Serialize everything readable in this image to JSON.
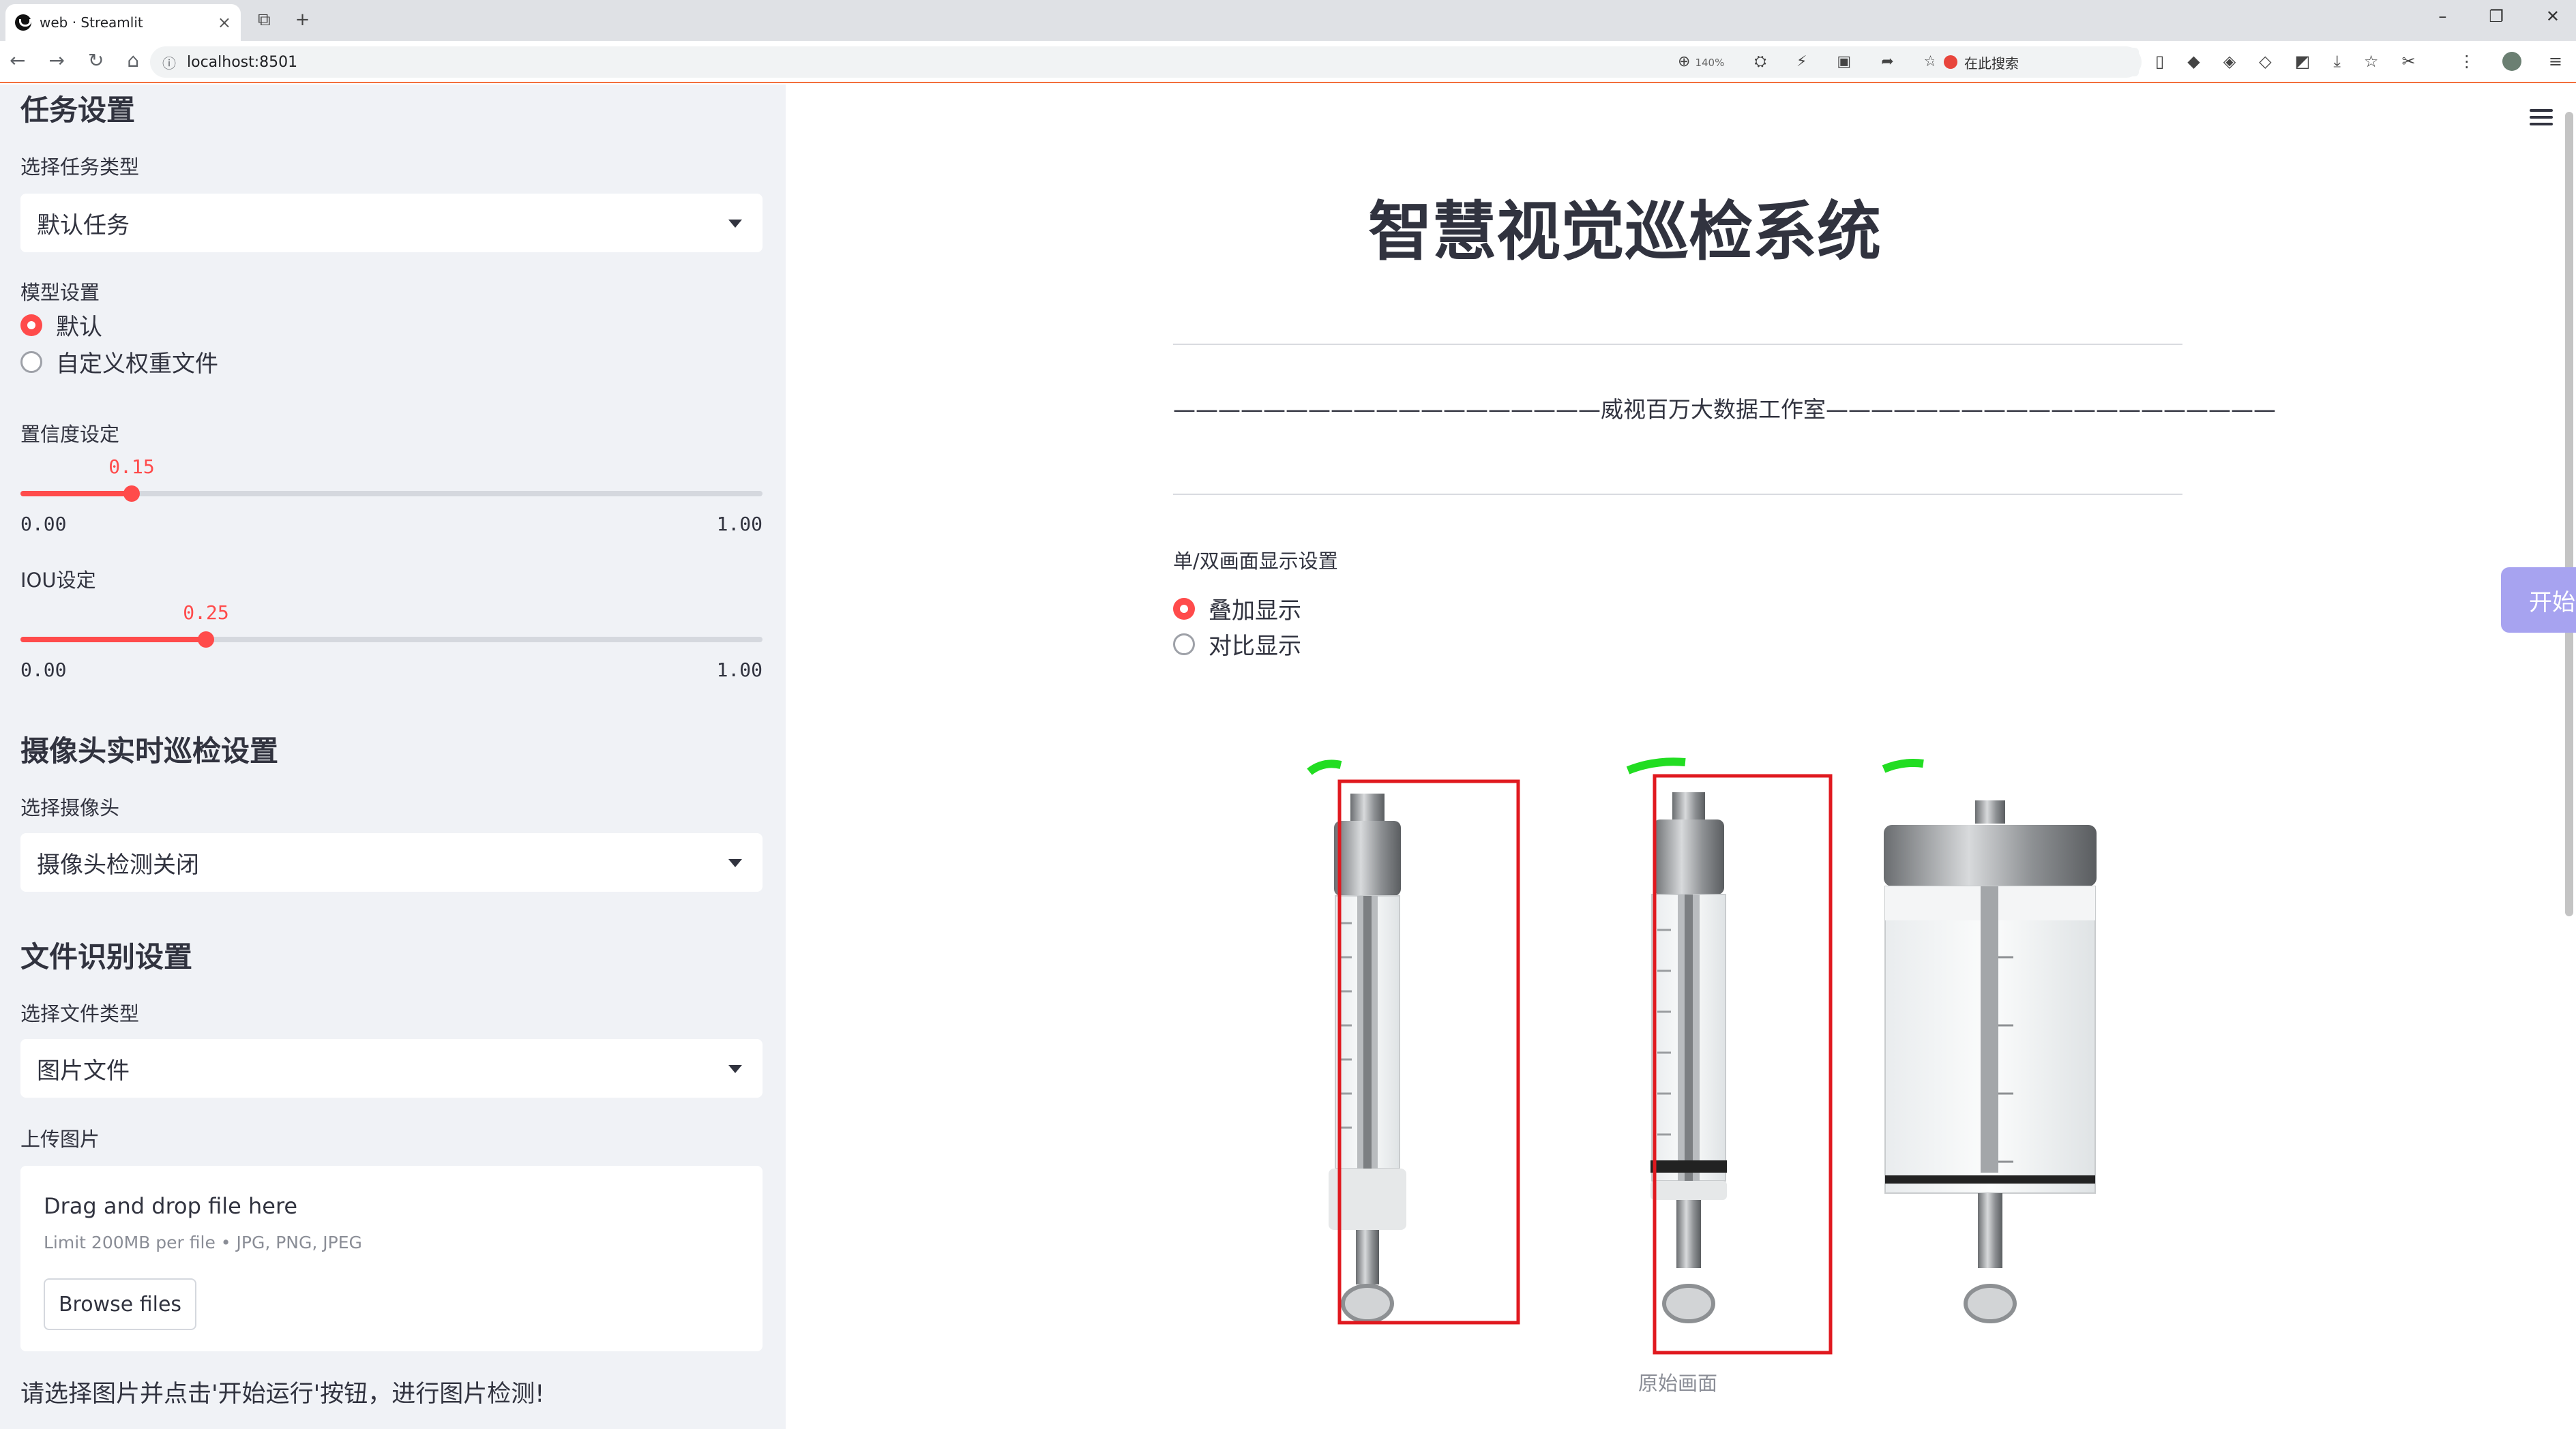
{
  "browser": {
    "tab_title": "web · Streamlit",
    "url": "localhost:8501",
    "zoom": "140%",
    "search_placeholder": "在此搜索"
  },
  "sidebar": {
    "task_header": "任务设置",
    "task_type_label": "选择任务类型",
    "task_type_value": "默认任务",
    "model_label": "模型设置",
    "model_options": [
      "默认",
      "自定义权重文件"
    ],
    "model_selected": "默认",
    "confidence": {
      "label": "置信度设定",
      "value": "0.15",
      "min": "0.00",
      "max": "1.00",
      "fraction": 0.15
    },
    "iou": {
      "label": "IOU设定",
      "value": "0.25",
      "min": "0.00",
      "max": "1.00",
      "fraction": 0.25
    },
    "camera_header": "摄像头实时巡检设置",
    "camera_label": "选择摄像头",
    "camera_value": "摄像头检测关闭",
    "file_header": "文件识别设置",
    "file_type_label": "选择文件类型",
    "file_type_value": "图片文件",
    "upload_label": "上传图片",
    "uploader": {
      "drag_text": "Drag and drop file here",
      "limit_text": "Limit 200MB per file • JPG, PNG, JPEG",
      "browse_label": "Browse files"
    },
    "note": "请选择图片并点击'开始运行'按钮，进行图片检测!"
  },
  "main": {
    "title": "智慧视觉巡检系统",
    "subtitle": "———————————————————威视百万大数据工作室————————————————————",
    "display_label": "单/双画面显示设置",
    "display_options": [
      "叠加显示",
      "对比显示"
    ],
    "display_selected": "叠加显示",
    "start_button": "开始检测",
    "image_caption": "原始画面"
  },
  "colors": {
    "accent": "#ff4b4b",
    "button": "#a7a3f0",
    "sidebar_bg": "#f0f2f6",
    "detection_box": "#e0191f"
  }
}
